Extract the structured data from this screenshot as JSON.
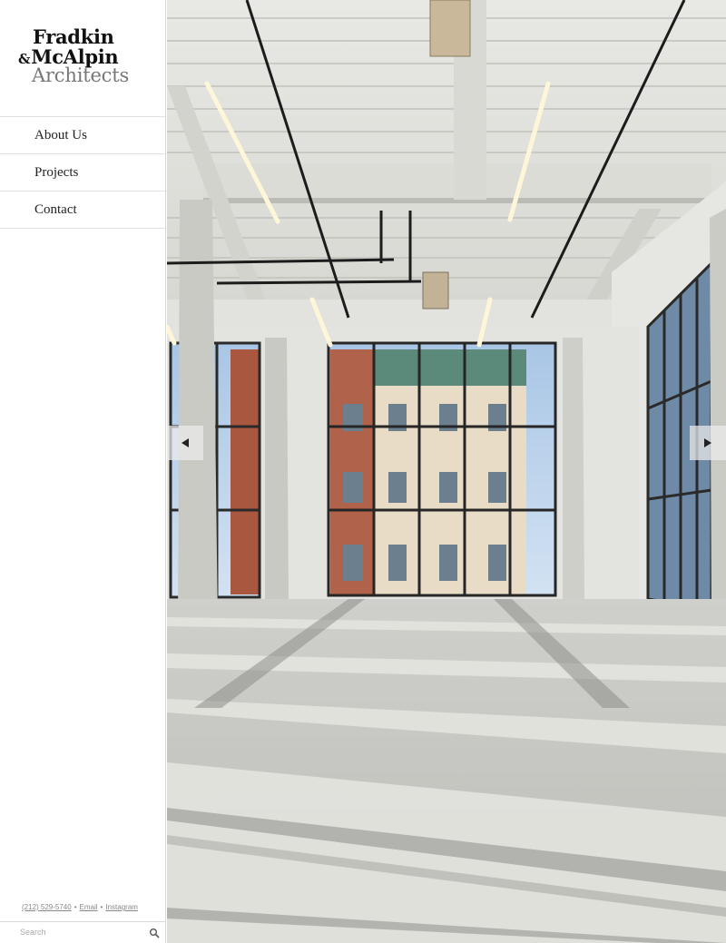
{
  "brand": {
    "line1": "Fradkin",
    "amp": "&",
    "line2": "McAlpin",
    "line3": "Architects"
  },
  "nav": {
    "items": [
      {
        "label": "About Us"
      },
      {
        "label": "Projects"
      },
      {
        "label": "Contact"
      }
    ]
  },
  "footer": {
    "phone": "(212) 529-5740",
    "separator": "•",
    "email": "Email",
    "instagram": "Instagram"
  },
  "search": {
    "placeholder": "Search",
    "icon": "search-icon"
  },
  "slideshow": {
    "prev_icon": "triangle-left-icon",
    "next_icon": "triangle-right-icon"
  }
}
